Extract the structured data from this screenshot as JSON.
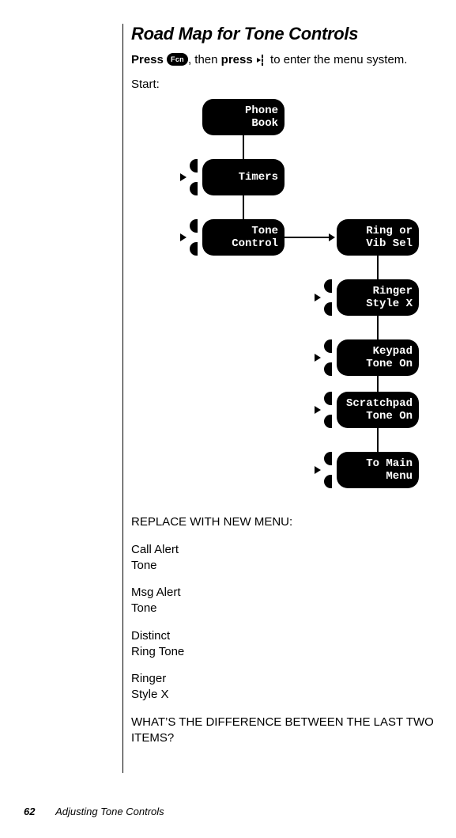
{
  "title": "Road Map for Tone Controls",
  "instruction": {
    "press1": "Press",
    "fcn": "Fcn",
    "then": ", then",
    "press2": "press",
    "tail": "to enter the menu system."
  },
  "start_label": "Start:",
  "menu": {
    "phone_book": "Phone\nBook",
    "timers": "Timers",
    "tone_control": "Tone\nControl",
    "ring_vib": "Ring or\nVib Sel",
    "ringer_style": "Ringer\nStyle X",
    "keypad": "Keypad\nTone On",
    "scratchpad": "Scratchpad\nTone On",
    "to_main": "To Main\nMenu"
  },
  "replace_heading": "REPLACE WITH NEW MENU:",
  "items": {
    "call_alert_l1": "Call Alert",
    "call_alert_l2": "Tone",
    "msg_alert_l1": "Msg Alert",
    "msg_alert_l2": "Tone",
    "distinct_l1": "Distinct",
    "distinct_l2": "Ring Tone",
    "ringer_l1": "Ringer",
    "ringer_l2": "Style X"
  },
  "question": "WHAT’S THE DIFFERENCE BETWEEN THE LAST TWO ITEMS?",
  "footer": {
    "page": "62",
    "section": "Adjusting Tone Controls"
  }
}
